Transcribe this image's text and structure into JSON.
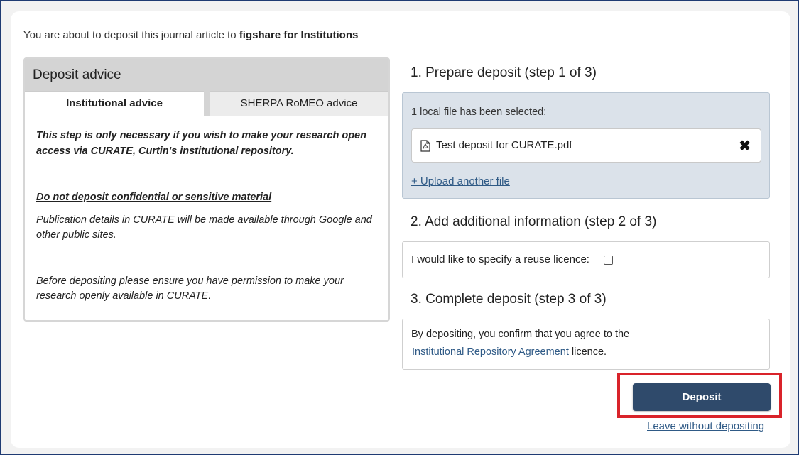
{
  "intro": {
    "prefix": "You are about to deposit this journal article to ",
    "target": "figshare for Institutions"
  },
  "advice": {
    "title": "Deposit advice",
    "tabs": [
      {
        "label": "Institutional advice",
        "active": true
      },
      {
        "label": "SHERPA RoMEO advice",
        "active": false
      }
    ],
    "paragraphs": [
      "This step is only necessary if you wish to make your research open access via CURATE, Curtin's institutional repository.",
      "Do not deposit confidential or sensitive material",
      "Publication details in CURATE will be made available through Google and other public sites.",
      "Before depositing please ensure you have permission to make your research openly available in CURATE."
    ]
  },
  "steps": {
    "prepare": {
      "title": "1. Prepare deposit (step 1 of 3)",
      "selected_text": "1 local file has been selected:",
      "file_name": "Test deposit for CURATE.pdf",
      "remove_symbol": "✖",
      "upload_link": "+ Upload another file"
    },
    "additional": {
      "title": "2. Add additional information (step 2 of 3)",
      "licence_label": "I would like to specify a reuse licence:",
      "licence_checked": false
    },
    "complete": {
      "title": "3. Complete deposit (step 3 of 3)",
      "confirm_text": "By depositing, you confirm that you agree to the",
      "agreement_link": "Institutional Repository Agreement",
      "agreement_suffix": " licence."
    }
  },
  "actions": {
    "deposit_label": "Deposit",
    "leave_label": "Leave without depositing"
  },
  "colors": {
    "primary_button": "#2f4a6b",
    "link": "#2f5a86",
    "highlight": "#d9232a",
    "prepare_bg": "#dbe2ea"
  }
}
